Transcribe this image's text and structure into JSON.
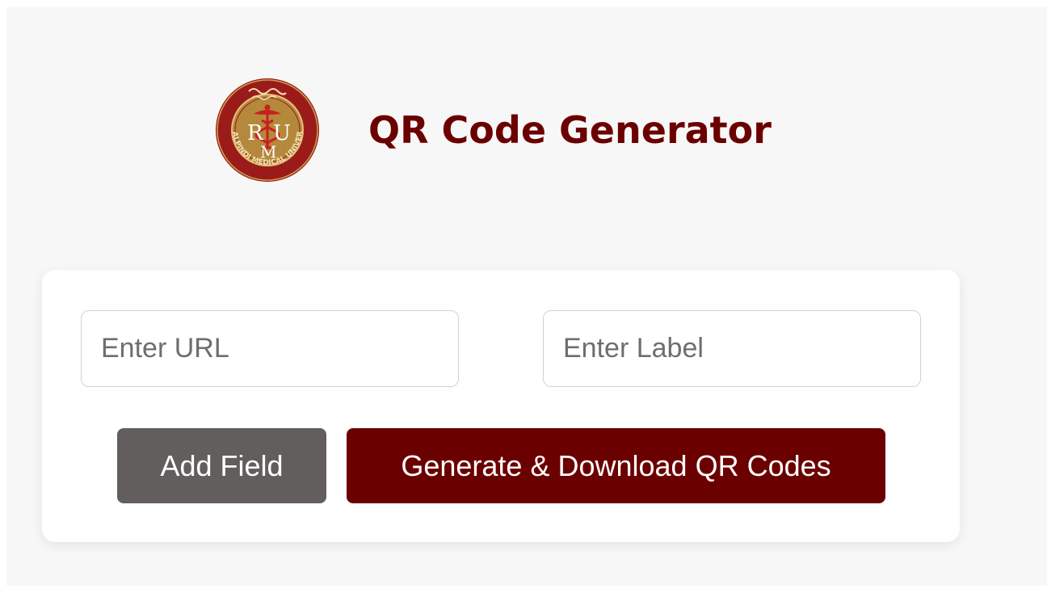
{
  "header": {
    "title": "QR Code Generator",
    "logo": {
      "name": "university-logo",
      "ring_text": "RAWALPINDI MEDICAL UNIVERSITY",
      "monogram_left": "R",
      "monogram_right": "U",
      "monogram_bottom": "M",
      "colors": {
        "ring": "#9b1b1b",
        "inner": "#b5893b",
        "emblem": "#c8201f"
      }
    }
  },
  "form": {
    "url_input": {
      "value": "",
      "placeholder": "Enter URL"
    },
    "label_input": {
      "value": "",
      "placeholder": "Enter Label"
    }
  },
  "buttons": {
    "add_field": "Add Field",
    "generate": "Generate & Download QR Codes"
  },
  "colors": {
    "accent": "#6b0000",
    "secondary_button": "#625e5e",
    "background": "#f7f7f7",
    "card": "#ffffff"
  }
}
